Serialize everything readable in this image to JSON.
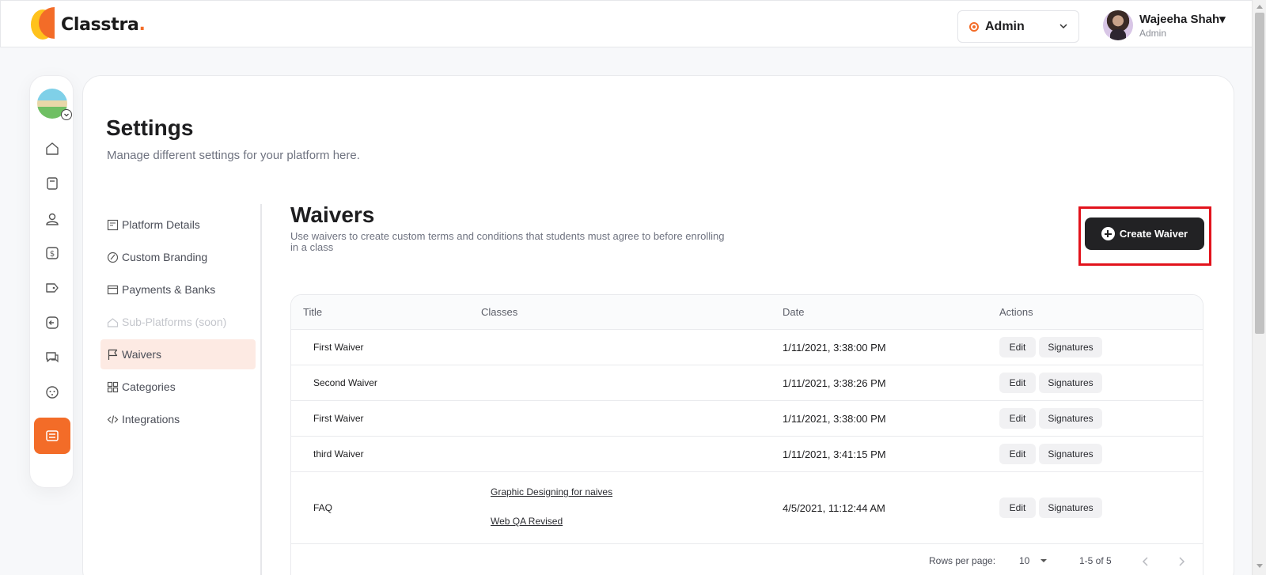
{
  "header": {
    "brand": "Classtra",
    "brand_dot": ".",
    "role": "Admin",
    "user_name": "Wajeeha Shah",
    "user_caret": "▾",
    "user_role": "Admin",
    "accent": "#f36c28"
  },
  "page": {
    "title": "Settings",
    "subtitle": "Manage different settings for your platform here."
  },
  "settings_menu": [
    {
      "label": "Platform Details",
      "icon": "platform-details-icon"
    },
    {
      "label": "Custom Branding",
      "icon": "custom-branding-icon"
    },
    {
      "label": "Payments & Banks",
      "icon": "payments-icon"
    },
    {
      "label": "Sub-Platforms (soon)",
      "icon": "sub-platforms-icon",
      "disabled": true
    },
    {
      "label": "Waivers",
      "icon": "flag-icon",
      "active": true
    },
    {
      "label": "Categories",
      "icon": "grid-icon"
    },
    {
      "label": "Integrations",
      "icon": "code-icon"
    }
  ],
  "waivers": {
    "title": "Waivers",
    "subtitle": "Use waivers to create custom terms and conditions that students must agree to before enrolling in a class",
    "create_label": "Create Waiver",
    "columns": [
      "Title",
      "Classes",
      "Date",
      "Actions"
    ],
    "rows": [
      {
        "title": "First Waiver",
        "classes": [],
        "date": "1/11/2021, 3:38:00 PM"
      },
      {
        "title": "Second Waiver",
        "classes": [],
        "date": "1/11/2021, 3:38:26 PM"
      },
      {
        "title": "First Waiver",
        "classes": [],
        "date": "1/11/2021, 3:38:00 PM"
      },
      {
        "title": "third Waiver",
        "classes": [],
        "date": "1/11/2021, 3:41:15 PM"
      },
      {
        "title": "FAQ",
        "classes": [
          "Graphic Designing for naives",
          "Web QA Revised"
        ],
        "date": "4/5/2021, 11:12:44 AM"
      }
    ],
    "edit_label": "Edit",
    "signatures_label": "Signatures",
    "pagination": {
      "rows_per_page_label": "Rows per page:",
      "rows_per_page": "10",
      "range": "1-5 of 5"
    }
  }
}
